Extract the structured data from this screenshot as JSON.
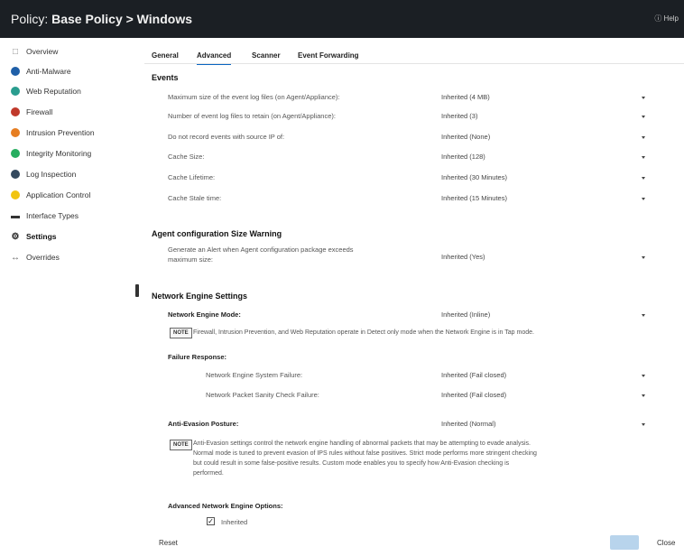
{
  "window": {
    "title_prefix": "Policy: ",
    "title_bold": "Base Policy > Windows",
    "help_label": "Help"
  },
  "sidebar": {
    "items": [
      {
        "label": "Overview",
        "icon": "overview-icon",
        "color": "#888888"
      },
      {
        "label": "Anti-Malware",
        "icon": "anti-malware-icon",
        "color": "#1f5fa8"
      },
      {
        "label": "Web Reputation",
        "icon": "web-reputation-icon",
        "color": "#2a9d8f"
      },
      {
        "label": "Firewall",
        "icon": "firewall-icon",
        "color": "#c0392b"
      },
      {
        "label": "Intrusion Prevention",
        "icon": "intrusion-prevention-icon",
        "color": "#e67e22"
      },
      {
        "label": "Integrity Monitoring",
        "icon": "integrity-monitoring-icon",
        "color": "#27ae60"
      },
      {
        "label": "Log Inspection",
        "icon": "log-inspection-icon",
        "color": "#34495e"
      },
      {
        "label": "Application Control",
        "icon": "application-control-icon",
        "color": "#f1c40f"
      },
      {
        "label": "Interface Types",
        "icon": "interface-types-icon",
        "color": "#333333"
      },
      {
        "label": "Settings",
        "icon": "gear-icon",
        "color": "#222222"
      },
      {
        "label": "Overrides",
        "icon": "overrides-icon",
        "color": "#666666"
      }
    ]
  },
  "tabs": [
    {
      "label": "General"
    },
    {
      "label": "Advanced"
    },
    {
      "label": "Scanner"
    },
    {
      "label": "Event Forwarding"
    }
  ],
  "events": {
    "heading": "Events",
    "rows": [
      {
        "label": "Maximum size of the event log files (on Agent/Appliance):",
        "value": "Inherited (4 MB)"
      },
      {
        "label": "Number of event log files to retain (on Agent/Appliance):",
        "value": "Inherited (3)"
      },
      {
        "label": "Do not record events with source IP of:",
        "value": "Inherited (None)"
      },
      {
        "label": "Cache Size:",
        "value": "Inherited (128)"
      },
      {
        "label": "Cache Lifetime:",
        "value": "Inherited (30 Minutes)"
      },
      {
        "label": "Cache Stale time:",
        "value": "Inherited (15 Minutes)"
      }
    ]
  },
  "agent_config": {
    "heading": "Agent configuration Size Warning",
    "label_line1": "Generate an Alert when Agent configuration package exceeds",
    "label_line2": "maximum size:",
    "value": "Inherited (Yes)"
  },
  "network_engine": {
    "heading": "Network Engine Settings",
    "mode_label": "Network Engine Mode:",
    "mode_value": "Inherited (Inline)",
    "mode_note_badge": "NOTE",
    "mode_note": "Firewall, Intrusion Prevention, and Web Reputation operate in Detect only mode when the Network Engine is in Tap mode.",
    "failure_heading": "Failure Response:",
    "failure_rows": [
      {
        "label": "Network Engine System Failure:",
        "value": "Inherited (Fail closed)"
      },
      {
        "label": "Network Packet Sanity Check Failure:",
        "value": "Inherited (Fail closed)"
      }
    ],
    "evasion_label": "Anti-Evasion Posture:",
    "evasion_value": "Inherited (Normal)",
    "evasion_note_badge": "NOTE",
    "evasion_note_lines": [
      "Anti-Evasion settings control the network engine handling of abnormal packets that may be attempting to evade analysis.",
      "Normal mode is tuned to prevent evasion of IPS rules without false positives. Strict mode performs more stringent checking",
      "but could result in some false-positive results. Custom mode enables you to specify how Anti-Evasion checking is",
      "performed."
    ],
    "advanced_label": "Advanced Network Engine Options:",
    "inherited_checkbox_label": "Inherited",
    "inherited_checked": true
  },
  "footer": {
    "reset_label": "Reset",
    "close_label": "Close"
  }
}
